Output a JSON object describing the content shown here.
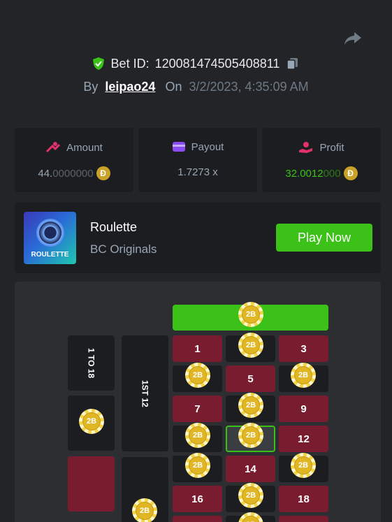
{
  "header": {
    "bet_id_label": "Bet ID:",
    "bet_id": "120081474505408811",
    "by_label": "By",
    "username": "leipao24",
    "on_label": "On",
    "date": "3/2/2023, 4:35:09 AM"
  },
  "stats": {
    "amount": {
      "label": "Amount",
      "value_main": "44.",
      "value_dim": "0000000",
      "coin": "Đ"
    },
    "payout": {
      "label": "Payout",
      "value": "1.7273 x"
    },
    "profit": {
      "label": "Profit",
      "value_main": "32.0012",
      "value_dim": "000",
      "coin": "Đ"
    }
  },
  "game": {
    "title": "Roulette",
    "subtitle": "BC Originals",
    "thumb_label": "ROULETTE",
    "play_label": "Play Now"
  },
  "board": {
    "side_labels": {
      "dozen1": "1 TO 18",
      "first12": "1ST 12"
    },
    "numbers": {
      "n1": "1",
      "n3": "3",
      "n5": "5",
      "n7": "7",
      "n9": "9",
      "n12": "12",
      "n14": "14",
      "n16": "16",
      "n18": "18"
    },
    "chip_label": "2B"
  },
  "colors": {
    "accent": "#3bc117",
    "red": "#7a1c30",
    "coin": "#c9a227"
  }
}
